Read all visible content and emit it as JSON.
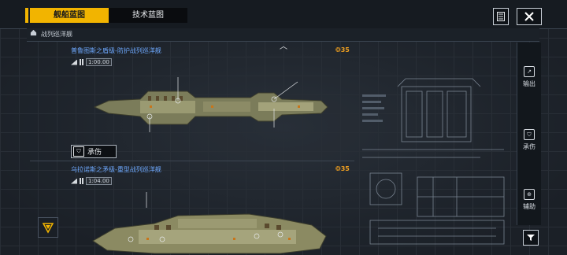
{
  "tabs": [
    {
      "label": "舰船蓝图",
      "active": true
    },
    {
      "label": "技术蓝图",
      "active": false
    }
  ],
  "breadcrumb": {
    "label": "战列巡洋舰"
  },
  "ships": [
    {
      "name": "普鲁图斯之盾级-防护战列巡洋舰",
      "scale": "1:00.00",
      "score": "35",
      "role": "承伤"
    },
    {
      "name": "乌拉诺斯之矛级-重型战列巡洋舰",
      "scale": "1:04.00",
      "score": "35"
    }
  ],
  "sidebar": {
    "items": [
      {
        "label": "输出",
        "icon": "output-icon"
      },
      {
        "label": "承伤",
        "icon": "tank-icon"
      },
      {
        "label": "辅助",
        "icon": "support-icon"
      }
    ]
  },
  "colors": {
    "accent": "#f2b400",
    "ship_title": "#6ea9ff",
    "score": "#f0a020"
  }
}
